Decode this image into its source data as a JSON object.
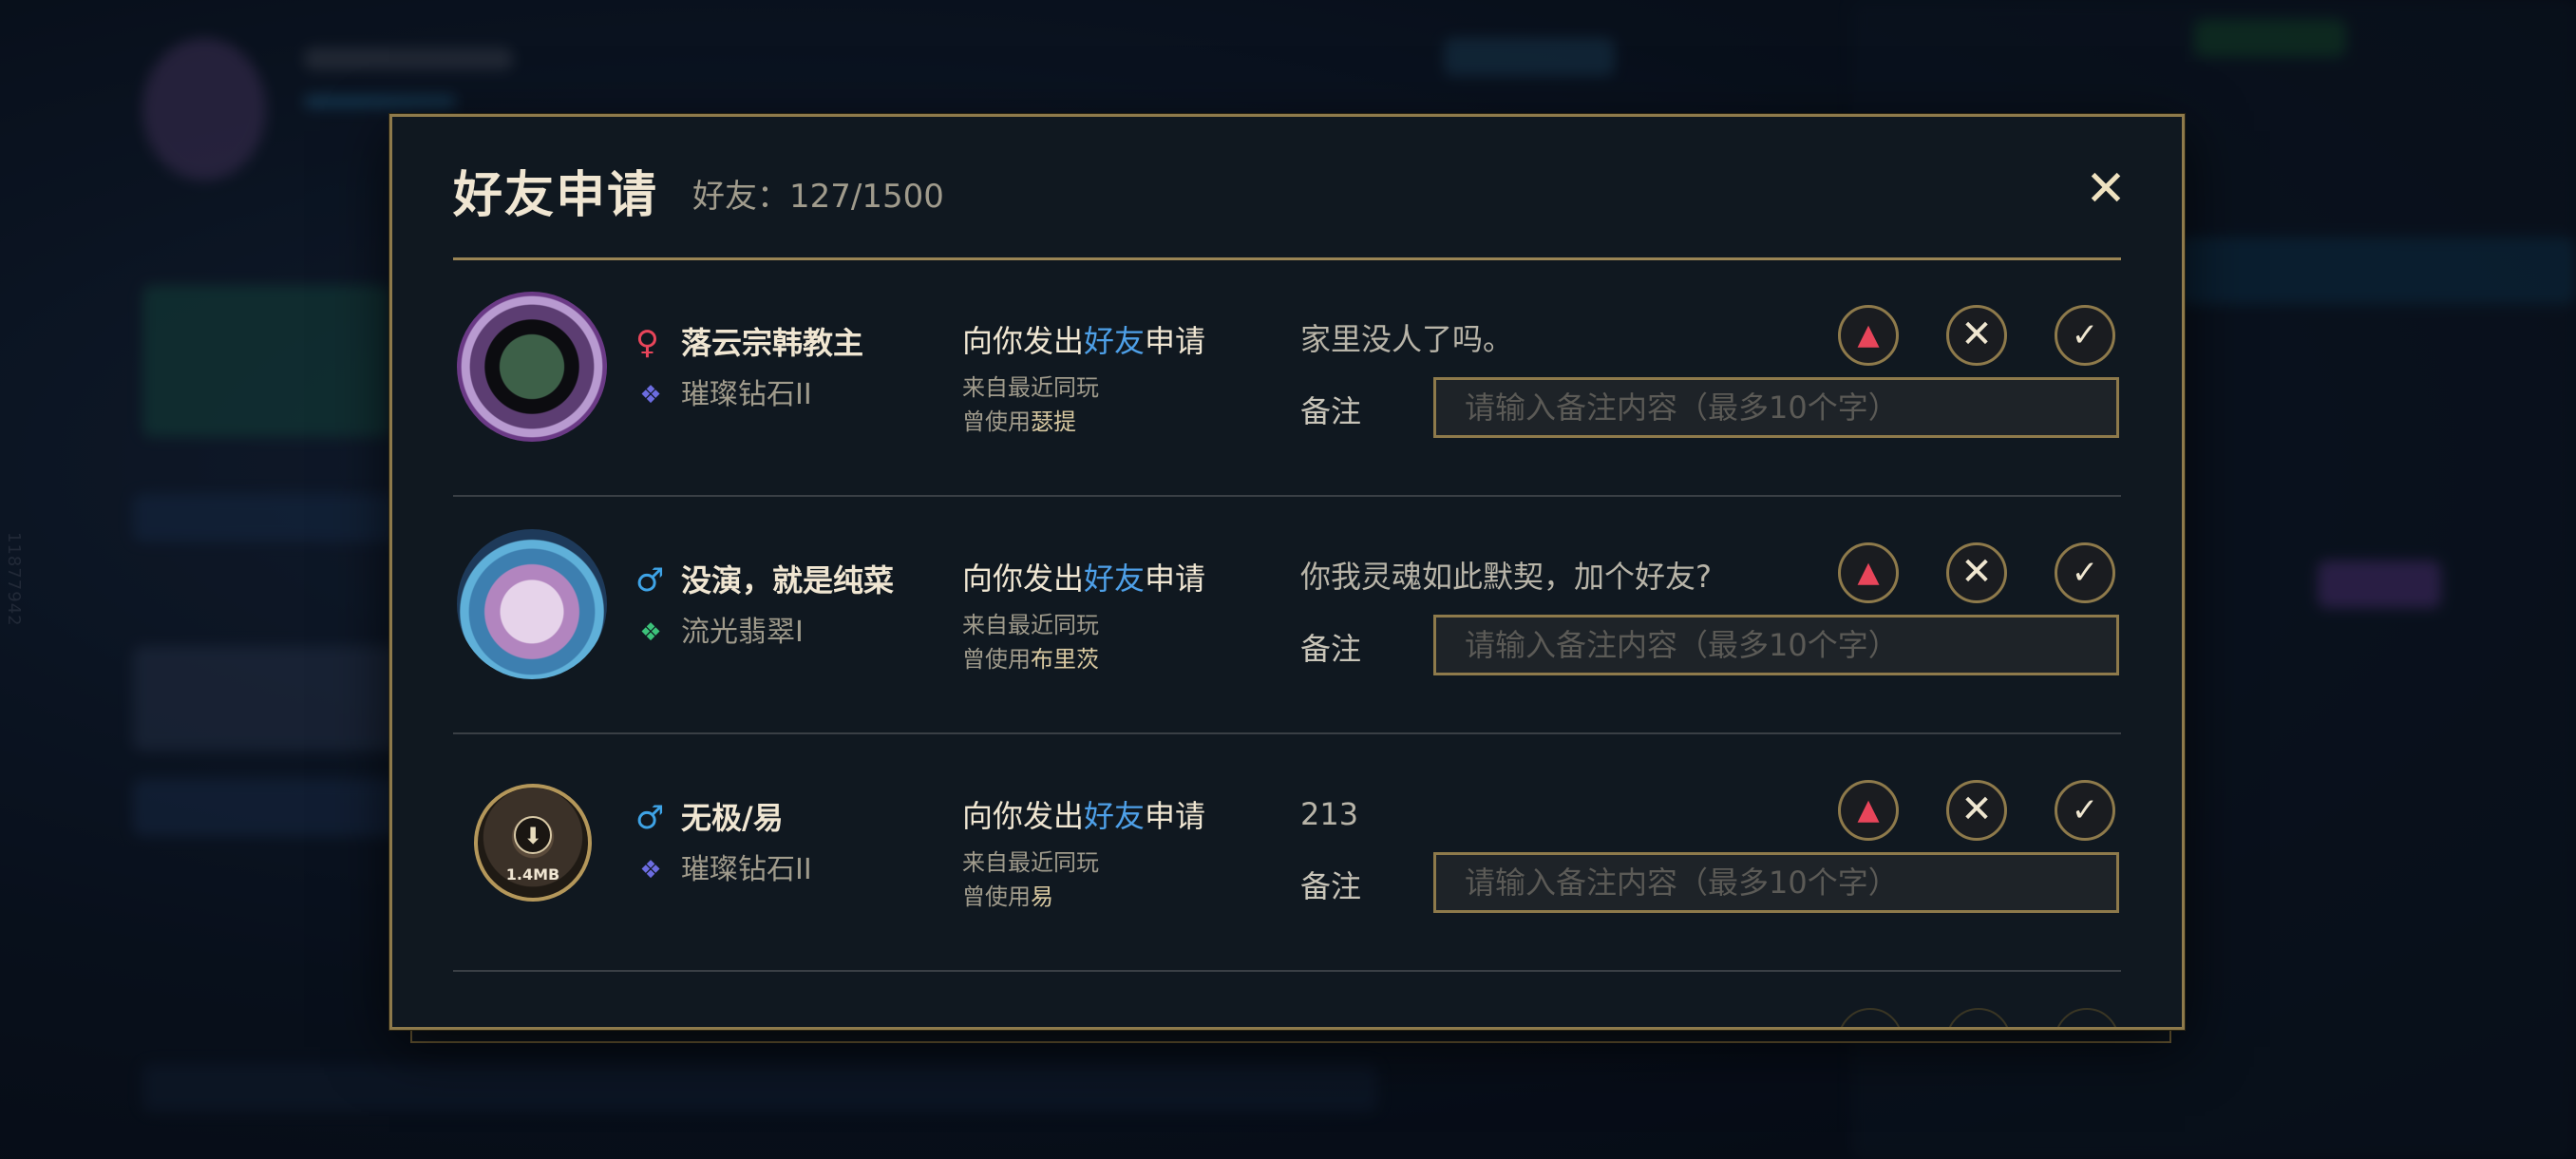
{
  "background": {
    "side_label": "11877942"
  },
  "dialog": {
    "title": "好友申请",
    "friend_count": "好友：127/1500",
    "close_glyph": "✕",
    "placeholder": "请输入备注内容（最多10个字）",
    "note_label": "备注",
    "request_prefix": "向你发出",
    "request_highlight": "好友",
    "request_suffix": "申请",
    "origin": "来自最近同玩",
    "used_prefix": "曾使用",
    "report_glyph": "▲",
    "decline_glyph": "✕",
    "accept_glyph": "✓"
  },
  "requests": [
    {
      "gender": "♀",
      "name": "落云宗韩教主",
      "rank": "璀璨钻石II",
      "rank_icon": "diamond-rank-icon",
      "champion": "瑟提",
      "message": "家里没人了吗。"
    },
    {
      "gender": "♂",
      "name": "没演，就是纯菜",
      "rank": "流光翡翠I",
      "rank_icon": "emerald-rank-icon",
      "champion": "布里茨",
      "message": "你我灵魂如此默契，加个好友?"
    },
    {
      "gender": "♂",
      "name": "无极/易",
      "rank": "璀璨钻石II",
      "rank_icon": "diamond-rank-icon",
      "champion": "易",
      "message": "213",
      "avatar_size_label": "1.4MB",
      "avatar_download_glyph": "⬇"
    }
  ],
  "colors": {
    "gold": "#8e7a4b",
    "highlight_blue": "#4ea0e8",
    "female": "#e8455a",
    "male": "#3ea3e6"
  }
}
